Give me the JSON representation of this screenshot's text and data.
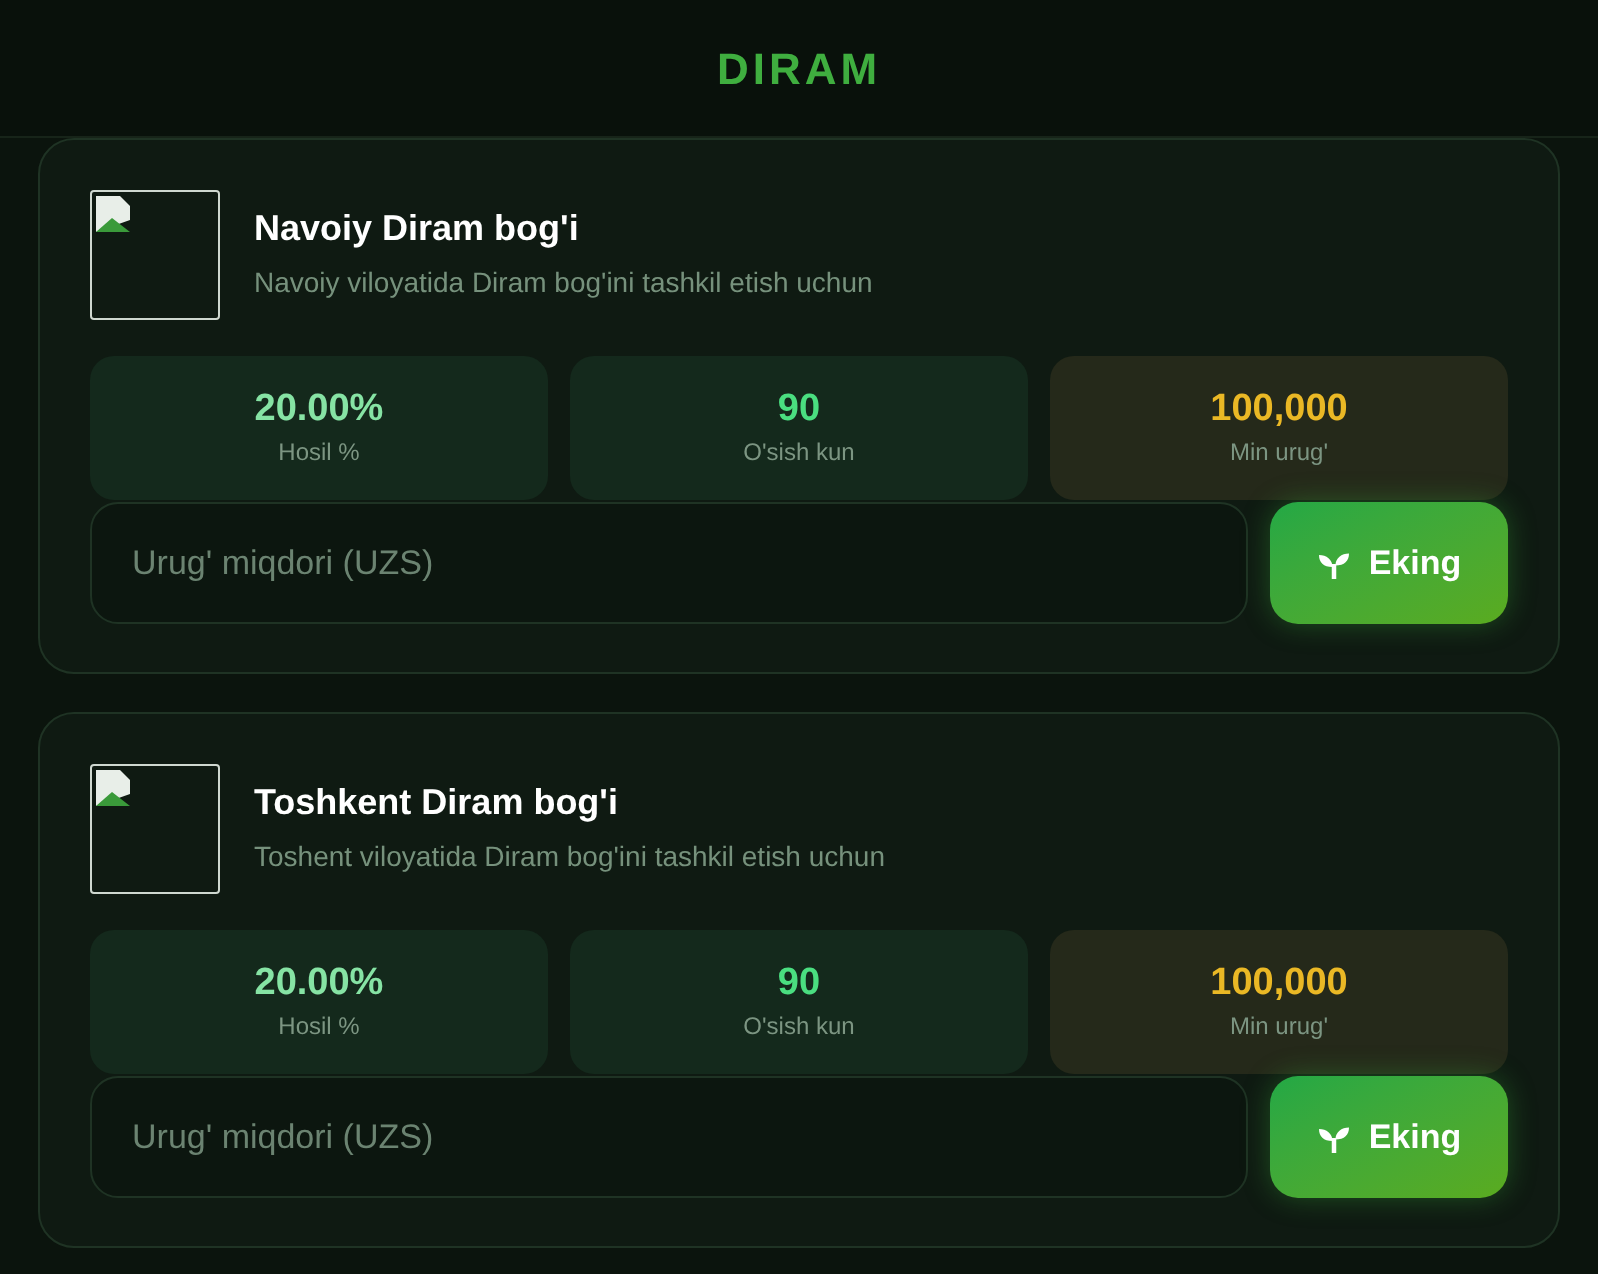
{
  "header": {
    "title": "DIRAM"
  },
  "gardens": [
    {
      "title": "Navoiy Diram bog'i",
      "description": "Navoiy viloyatida Diram bog'ini tashkil etish uchun",
      "stats": [
        {
          "value": "20.00%",
          "label": "Hosil %",
          "kind": "normal",
          "color": "#86e3a4"
        },
        {
          "value": "90",
          "label": "O'sish kun",
          "kind": "normal",
          "color": "#4ade80"
        },
        {
          "value": "100,000",
          "label": "Min urug'",
          "kind": "highlight",
          "color": "#eab825"
        }
      ],
      "input": {
        "placeholder": "Urug' miqdori (UZS)"
      },
      "button": "Eking"
    },
    {
      "title": "Toshkent Diram bog'i",
      "description": "Toshent viloyatida Diram bog'ini tashkil etish uchun",
      "stats": [
        {
          "value": "20.00%",
          "label": "Hosil %",
          "kind": "normal",
          "color": "#86e3a4"
        },
        {
          "value": "90",
          "label": "O'sish kun",
          "kind": "normal",
          "color": "#4ade80"
        },
        {
          "value": "100,000",
          "label": "Min urug'",
          "kind": "highlight",
          "color": "#eab825"
        }
      ],
      "input": {
        "placeholder": "Urug' miqdori (UZS)"
      },
      "button": "Eking"
    }
  ]
}
